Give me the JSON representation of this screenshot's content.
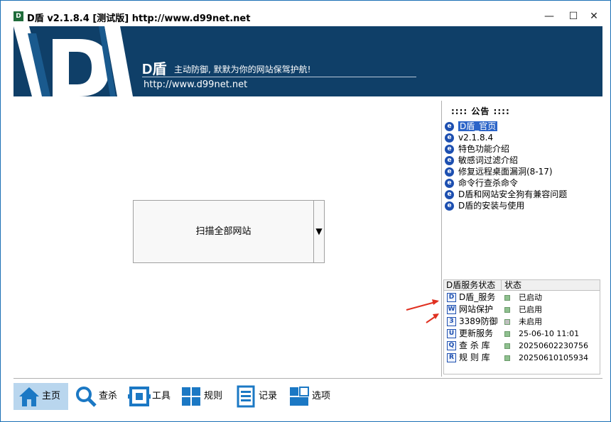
{
  "window": {
    "title": "D盾 v2.1.8.4 [测试版] http://www.d99net.net",
    "app_icon_text": "D盾",
    "minimize": "—",
    "maximize": "☐",
    "close": "✕"
  },
  "banner": {
    "brand": "D盾",
    "slogan": "主动防御, 默默为你的网站保驾护航!",
    "url": "http://www.d99net.net"
  },
  "main": {
    "scan_button_label": "扫描全部网站",
    "scan_button_arrow": "▼"
  },
  "notice": {
    "title": ":::: 公告 ::::",
    "items": [
      {
        "label": "D盾_官页",
        "icon": "e-icon"
      },
      {
        "label": "v2.1.8.4",
        "icon": "e-icon"
      },
      {
        "label": "特色功能介绍",
        "icon": "e-icon"
      },
      {
        "label": "敏感词过滤介绍",
        "icon": "e-icon"
      },
      {
        "label": "修复远程桌面漏洞(8-17)",
        "icon": "e-icon"
      },
      {
        "label": "命令行查杀命令",
        "icon": "e-icon"
      },
      {
        "label": "D盾和网站安全狗有兼容问题",
        "icon": "e-icon"
      },
      {
        "label": "D盾的安装与使用",
        "icon": "e-icon"
      }
    ]
  },
  "status": {
    "header_name": "D盾服务状态",
    "header_state": "状态",
    "rows": [
      {
        "icon_text": "D",
        "name": "D盾_服务",
        "value": "已启动",
        "dot_color": "#8fc08f"
      },
      {
        "icon_text": "W",
        "name": "网站保护",
        "value": "已启用",
        "dot_color": "#8fc08f"
      },
      {
        "icon_text": "3",
        "name": "3389防御",
        "value": "未启用",
        "dot_color": "#c0c0c0"
      },
      {
        "icon_text": "U",
        "name": "更新服务",
        "value": "25-06-10 11:01",
        "dot_color": "#8fc08f"
      },
      {
        "icon_text": "Q",
        "name": "查 杀 库",
        "value": "20250602230756",
        "dot_color": "#8fc08f"
      },
      {
        "icon_text": "R",
        "name": "规 则 库",
        "value": "20250610105934",
        "dot_color": "#8fc08f"
      }
    ]
  },
  "toolbar": {
    "home": "主页",
    "scan": "查杀",
    "tools": "工具",
    "rules": "规则",
    "log": "记录",
    "options": "选项"
  },
  "colors": {
    "banner_bg": "#0f3f68",
    "accent": "#1d4fb0",
    "toolbar_icon": "#1b78c4",
    "annotation_arrow": "#e03020"
  }
}
